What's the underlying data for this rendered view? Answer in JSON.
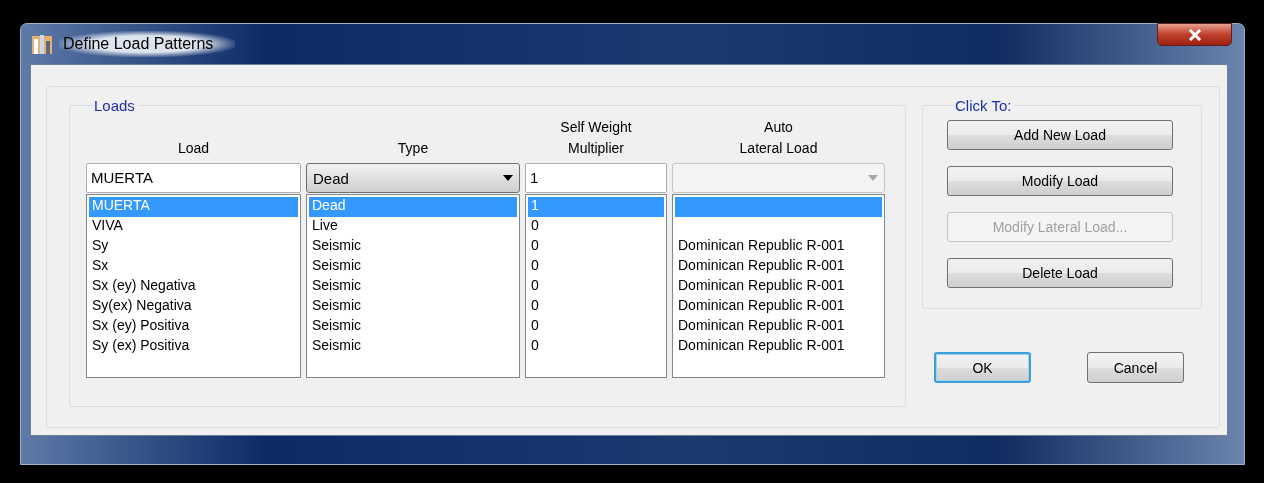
{
  "window": {
    "title": "Define Load Patterns"
  },
  "loads_group": {
    "title": "Loads",
    "columns": [
      {
        "lines": [
          "Load"
        ]
      },
      {
        "lines": [
          "Type"
        ]
      },
      {
        "lines": [
          "Self Weight",
          "Multiplier"
        ]
      },
      {
        "lines": [
          "Auto",
          "Lateral Load"
        ]
      }
    ],
    "load_field": {
      "value": "MUERTA"
    },
    "type_dropdown": {
      "value": "Dead",
      "disabled": false
    },
    "multiplier_field": {
      "value": "1"
    },
    "auto_lateral_dropdown": {
      "disabled": true
    },
    "rows": [
      {
        "load": "MUERTA",
        "type": "Dead",
        "multiplier": "1",
        "selected": true
      },
      {
        "load": "VIVA",
        "type": "Live",
        "multiplier": "0",
        "selected": false
      },
      {
        "load": "Sy",
        "type": "Seismic",
        "multiplier": "0",
        "auto_lateral": "Dominican Republic R-001",
        "selected": false
      },
      {
        "load": "Sx",
        "type": "Seismic",
        "multiplier": "0",
        "auto_lateral": "Dominican Republic R-001",
        "selected": false
      },
      {
        "load": "Sx (ey) Negativa",
        "type": "Seismic",
        "multiplier": "0",
        "auto_lateral": "Dominican Republic R-001",
        "selected": false
      },
      {
        "load": "Sy(ex) Negativa",
        "type": "Seismic",
        "multiplier": "0",
        "auto_lateral": "Dominican Republic R-001",
        "selected": false
      },
      {
        "load": "Sx (ey) Positiva",
        "type": "Seismic",
        "multiplier": "0",
        "auto_lateral": "Dominican Republic R-001",
        "selected": false
      },
      {
        "load": "Sy (ex) Positiva",
        "type": "Seismic",
        "multiplier": "0",
        "auto_lateral": "Dominican Republic R-001",
        "selected": false
      }
    ]
  },
  "click_to_group": {
    "title": "Click To:",
    "buttons": [
      {
        "label": "Add New Load",
        "disabled": false
      },
      {
        "label": "Modify Load",
        "disabled": false
      },
      {
        "label": "Modify Lateral Load...",
        "disabled": true
      },
      {
        "label": "Delete Load",
        "disabled": false
      }
    ]
  },
  "dialog_buttons": [
    {
      "label": "OK",
      "default": true
    },
    {
      "label": "Cancel",
      "default": false
    }
  ]
}
